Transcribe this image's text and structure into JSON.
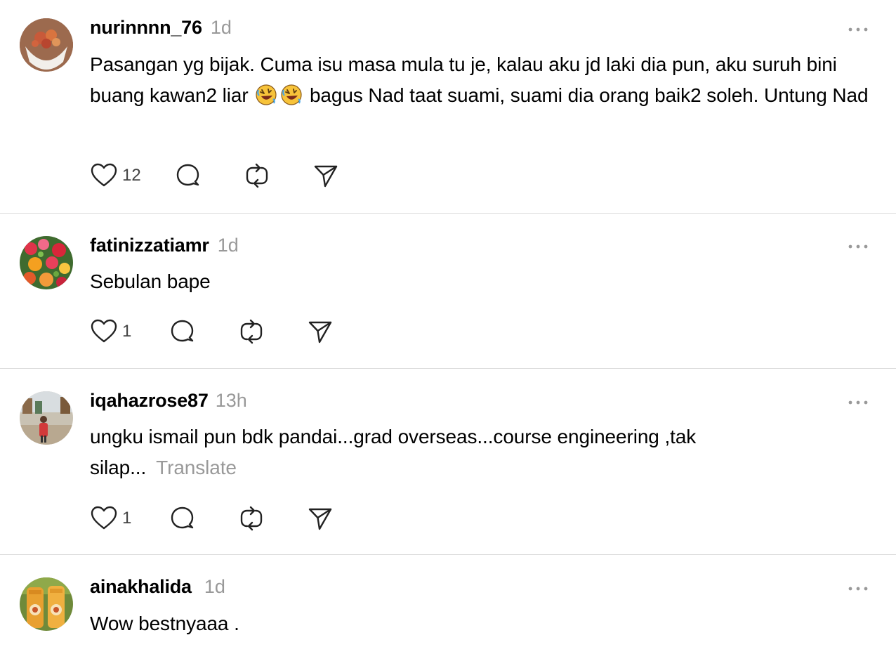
{
  "posts": [
    {
      "username": "nurinnnn_76",
      "time": "1d",
      "text_part1": "Pasangan yg bijak. Cuma isu masa mula tu je, kalau aku jd laki dia pun, aku suruh bini buang kawan2 liar",
      "emojis": [
        "rolling-on-floor-laughing-emoji",
        "rolling-on-floor-laughing-emoji"
      ],
      "text_part2": "bagus Nad taat suami, suami dia orang baik2 soleh. Untung Nad",
      "like_count": "12",
      "avatar": "food-avatar"
    },
    {
      "username": "fatinizzatiamr",
      "time": "1d",
      "text": "Sebulan bape",
      "like_count": "1",
      "avatar": "flowers-avatar"
    },
    {
      "username": "iqahazrose87",
      "time": "13h",
      "text": "ungku ismail pun bdk pandai...grad overseas...course engineering ,tak silap...",
      "translate_label": "Translate",
      "like_count": "1",
      "avatar": "person-outdoors-avatar"
    },
    {
      "username": "ainakhalida",
      "time": "1d",
      "text": "Wow bestnyaaa .",
      "avatar": "bottles-avatar"
    }
  ],
  "icons": {
    "like": "heart-icon",
    "reply": "comment-bubble-icon",
    "repost": "repost-icon",
    "share": "send-icon",
    "more": "more-options-icon"
  },
  "colors": {
    "text": "#000000",
    "secondary": "#999999",
    "divider": "#dbdbdb"
  }
}
